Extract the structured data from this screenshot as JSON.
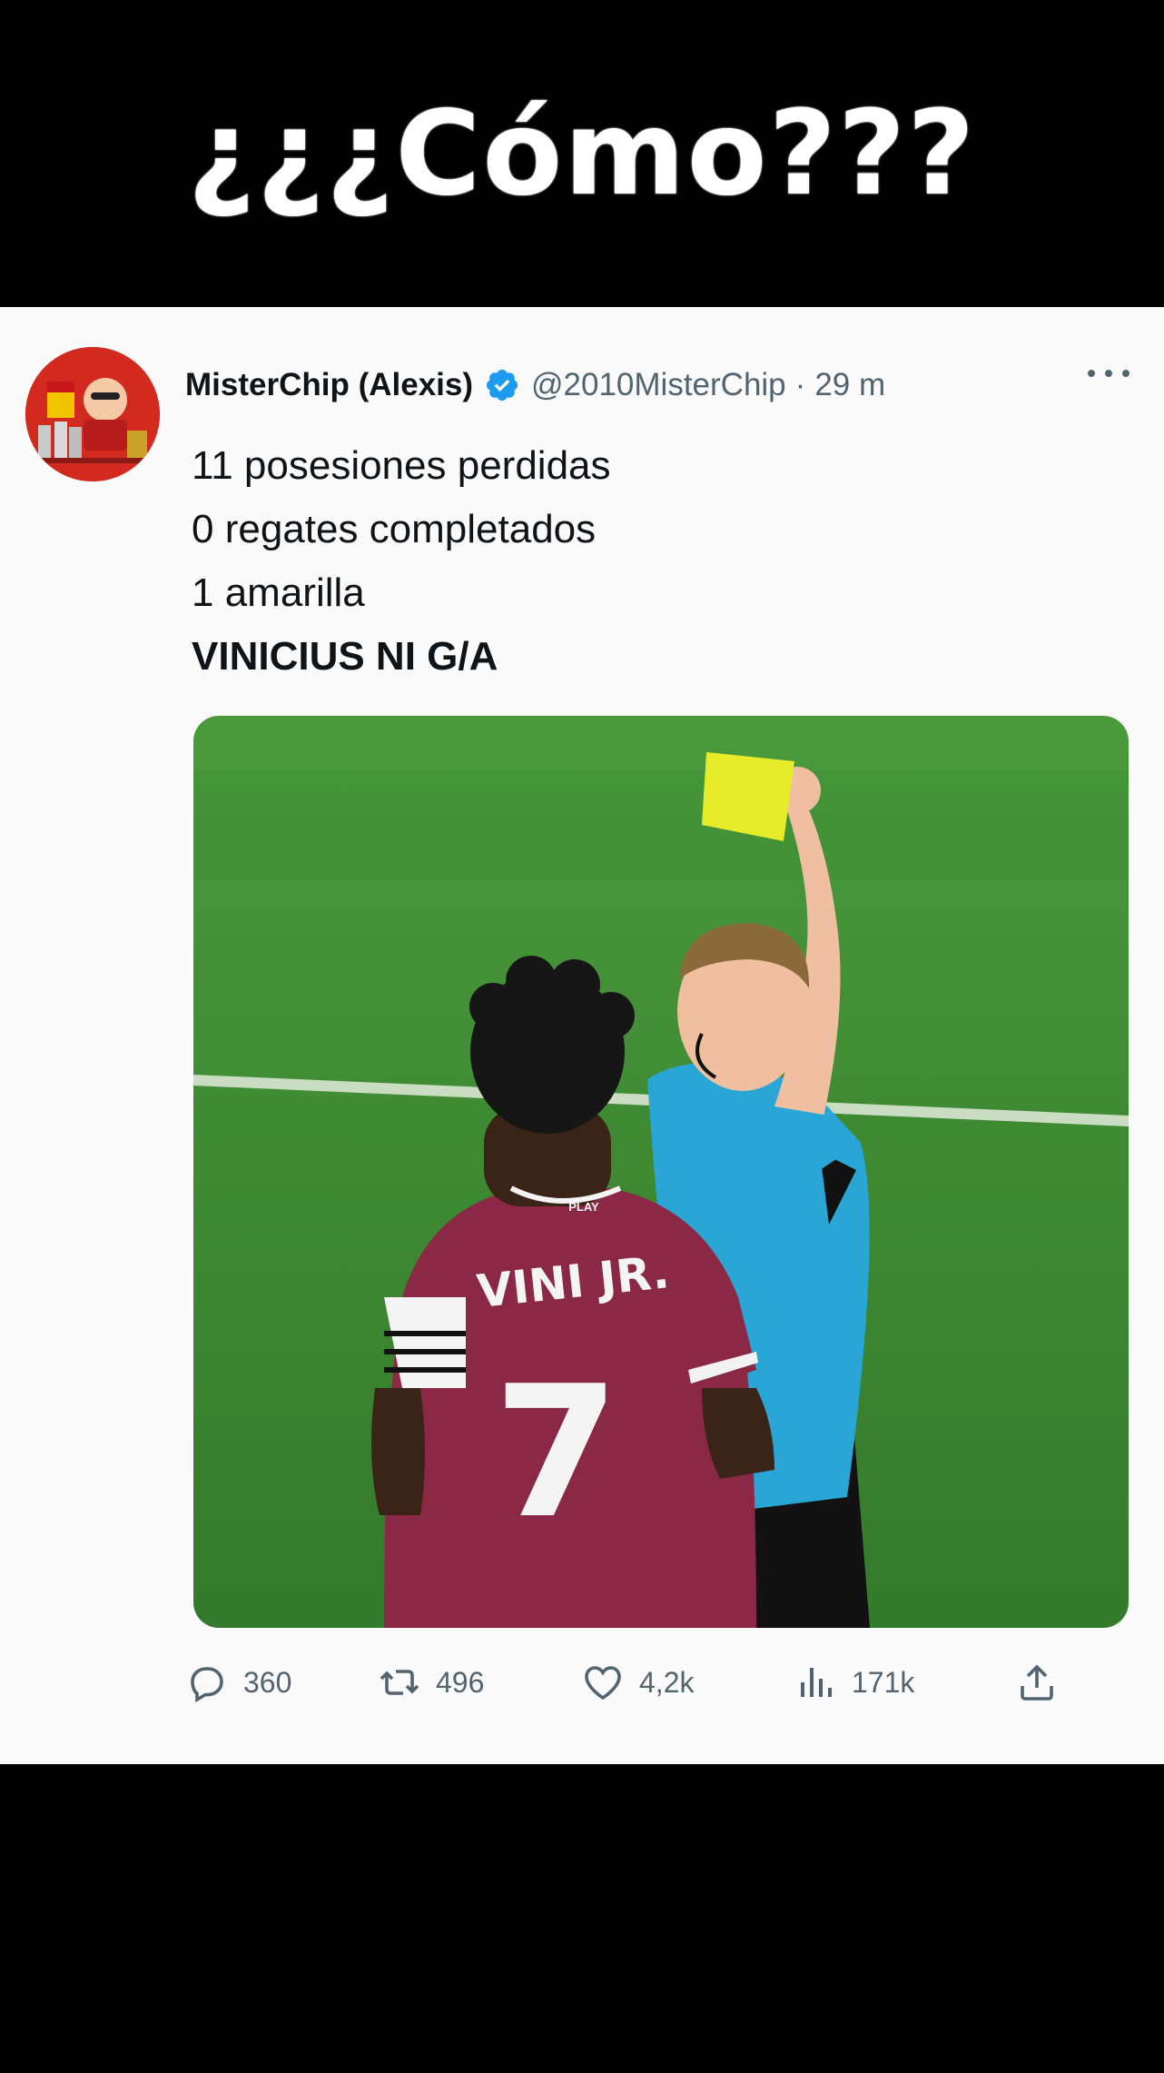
{
  "caption": "¿¿¿Cómo???",
  "tweet": {
    "display_name": "MisterChip (Alexis)",
    "handle": "@2010MisterChip",
    "separator": "·",
    "time": "29 m",
    "lines": [
      "11 posesiones perdidas",
      "0 regates completados",
      "1 amarilla",
      "VINICIUS NI G/A"
    ],
    "media": {
      "jersey_name": "VINI JR.",
      "jersey_number": "7",
      "sponsor": "PLAY",
      "colors": {
        "pitch": "#3f8c34",
        "referee_shirt": "#2aa6d6",
        "jersey": "#8a2845",
        "card": "#e6ec2a"
      }
    },
    "metrics": {
      "replies": "360",
      "retweets": "496",
      "likes": "4,2k",
      "views": "171k"
    },
    "icons": [
      "reply-icon",
      "retweet-icon",
      "like-icon",
      "views-icon",
      "share-icon",
      "verified-badge-icon",
      "more-options-icon"
    ],
    "accent": "#1d9bf0"
  }
}
